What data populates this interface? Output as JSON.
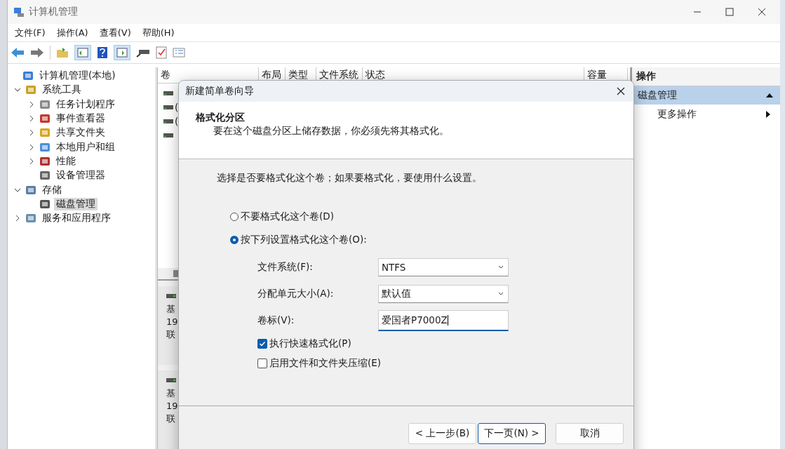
{
  "window": {
    "title": "计算机管理"
  },
  "menu": [
    "文件(F)",
    "操作(A)",
    "查看(V)",
    "帮助(H)"
  ],
  "tree": [
    {
      "label": "计算机管理(本地)",
      "selected": false,
      "children": [
        {
          "label": "系统工具",
          "expanded": true,
          "selected": false,
          "children": [
            {
              "label": "任务计划程序",
              "expanded": false,
              "selected": false
            },
            {
              "label": "事件查看器",
              "expanded": false,
              "selected": false
            },
            {
              "label": "共享文件夹",
              "expanded": false,
              "selected": false
            },
            {
              "label": "本地用户和组",
              "expanded": false,
              "selected": false
            },
            {
              "label": "性能",
              "expanded": false,
              "selected": false
            },
            {
              "label": "设备管理器",
              "selected": false
            }
          ]
        },
        {
          "label": "存储",
          "expanded": true,
          "selected": false,
          "children": [
            {
              "label": "磁盘管理",
              "selected": true
            }
          ]
        },
        {
          "label": "服务和应用程序",
          "expanded": false,
          "selected": false
        }
      ]
    }
  ],
  "volume_table": {
    "columns": [
      "卷",
      "布局",
      "类型",
      "文件系统",
      "状态",
      "容量"
    ],
    "rows": [
      {},
      {
        "column_1": "("
      },
      {
        "column_1": "("
      },
      {}
    ]
  },
  "disks": [
    {
      "line_1": "基",
      "line_2": "19",
      "line_3": "联"
    },
    {
      "line_1": "基",
      "line_2": "19",
      "line_3": "联"
    }
  ],
  "actions": {
    "title": "操作",
    "section": "磁盘管理",
    "items": [
      "更多操作"
    ]
  },
  "dialog": {
    "title": "新建简单卷向导",
    "heading": "格式化分区",
    "subheading": "要在这个磁盘分区上储存数据，你必须先将其格式化。",
    "prompt": "选择是否要格式化这个卷；如果要格式化，要使用什么设置。",
    "options": [
      {
        "label": "不要格式化这个卷(D)",
        "selected": false
      },
      {
        "label": "按下列设置格式化这个卷(O):",
        "selected": true
      }
    ],
    "fields": [
      {
        "kind": "select",
        "label": "文件系统(F):",
        "value": "NTFS"
      },
      {
        "kind": "select",
        "label": "分配单元大小(A):",
        "value": "默认值"
      },
      {
        "kind": "text",
        "label": "卷标(V):",
        "value": "爱国者P7000Z"
      }
    ],
    "checkboxes": [
      {
        "label": "执行快速格式化(P)",
        "checked": true
      },
      {
        "label": "启用文件和文件夹压缩(E)",
        "checked": false
      }
    ],
    "buttons": [
      {
        "label": "< 上一步(B)",
        "default": false
      },
      {
        "label": "下一页(N) >",
        "default": true
      },
      {
        "label": "取消",
        "default": false
      }
    ]
  }
}
